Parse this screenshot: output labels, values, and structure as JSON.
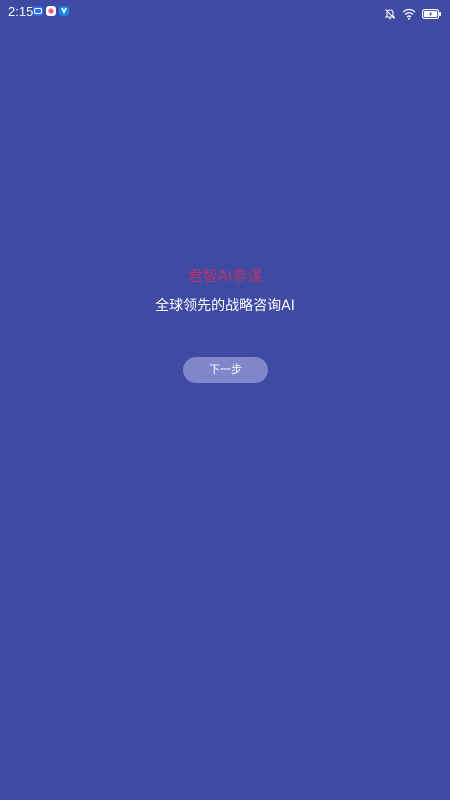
{
  "status_bar": {
    "time": "2:15",
    "app_icons": [
      "message-app-icon",
      "pink-app-icon",
      "vpn-app-icon"
    ],
    "right_icons": [
      "mute-icon",
      "wifi-icon",
      "battery-charging-icon"
    ]
  },
  "hero": {
    "brand_title": "君智AI参谋",
    "subtitle": "全球领先的战略咨询AI"
  },
  "actions": {
    "next_label": "下一步"
  },
  "colors": {
    "background": "#3f4aa3",
    "brand_title": "#b2356e",
    "button_bg": "#7f86c9"
  }
}
